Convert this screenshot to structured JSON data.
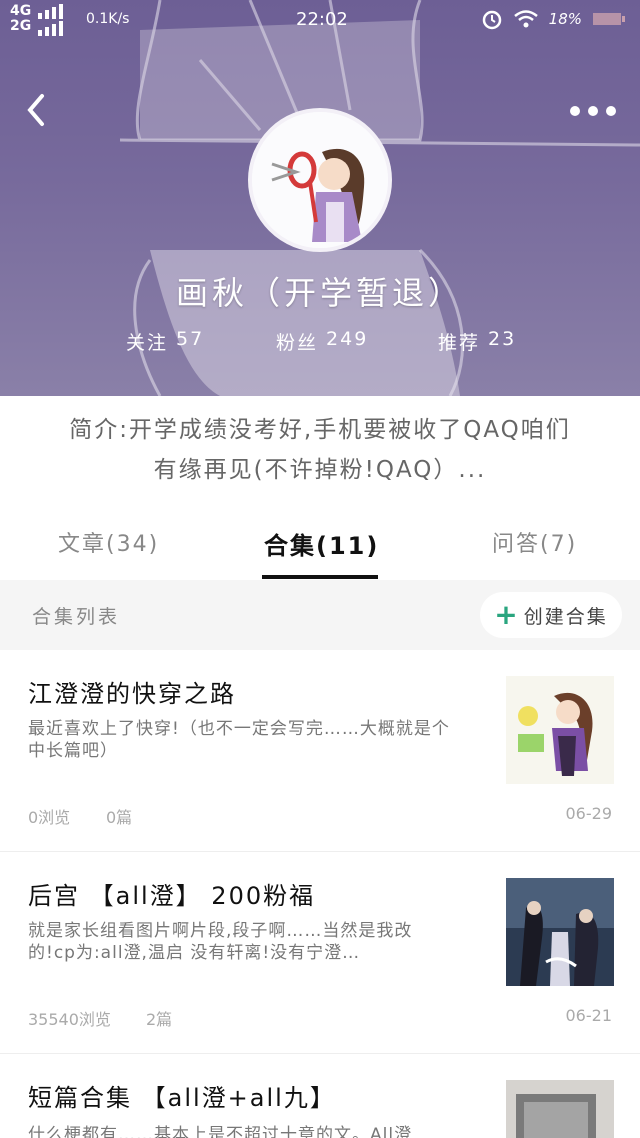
{
  "status_bar": {
    "network_top": "4G",
    "network_bottom": "2G",
    "speed": "0.1K/s",
    "time": "22:02",
    "battery": "18%"
  },
  "profile": {
    "name": "画秋（开学暂退）",
    "stats": [
      {
        "label": "关注",
        "value": "57"
      },
      {
        "label": "粉丝",
        "value": "249"
      },
      {
        "label": "推荐",
        "value": "23"
      }
    ],
    "bio_line1": "简介:开学成绩没考好,手机要被收了QAQ咱们",
    "bio_line2": "有缘再见(不许掉粉!QAQ）..."
  },
  "tabs": [
    {
      "label": "文章(34)",
      "active": false
    },
    {
      "label": "合集(11)",
      "active": true
    },
    {
      "label": "问答(7)",
      "active": false
    }
  ],
  "section": {
    "title": "合集列表",
    "create_label": "创建合集"
  },
  "items": [
    {
      "title": "江澄澄的快穿之路",
      "desc": "最近喜欢上了快穿!（也不一定会写完……大概就是个中长篇吧）",
      "views": "0浏览",
      "count": "0篇",
      "date": "06-29"
    },
    {
      "title": "后宫 【all澄】 200粉福",
      "desc": "就是家长组看图片啊片段,段子啊……当然是我改的!cp为:all澄,温启 没有轩离!没有宁澄…",
      "views": "35540浏览",
      "count": "2篇",
      "date": "06-21"
    },
    {
      "title": "短篇合集 【all澄+all九】",
      "desc": "什么梗都有……基本上是不超过十章的文。All澄",
      "views": "",
      "count": "",
      "date": ""
    }
  ],
  "colors": {
    "banner": "#776a9c",
    "accent_plus": "#2aa57f",
    "active_tab": "#111111"
  },
  "icons": {
    "back": "chevron-left-icon",
    "more": "more-dots-icon",
    "create": "plus-icon",
    "alarm": "alarm-icon",
    "wifi": "wifi-icon",
    "battery": "battery-icon"
  }
}
